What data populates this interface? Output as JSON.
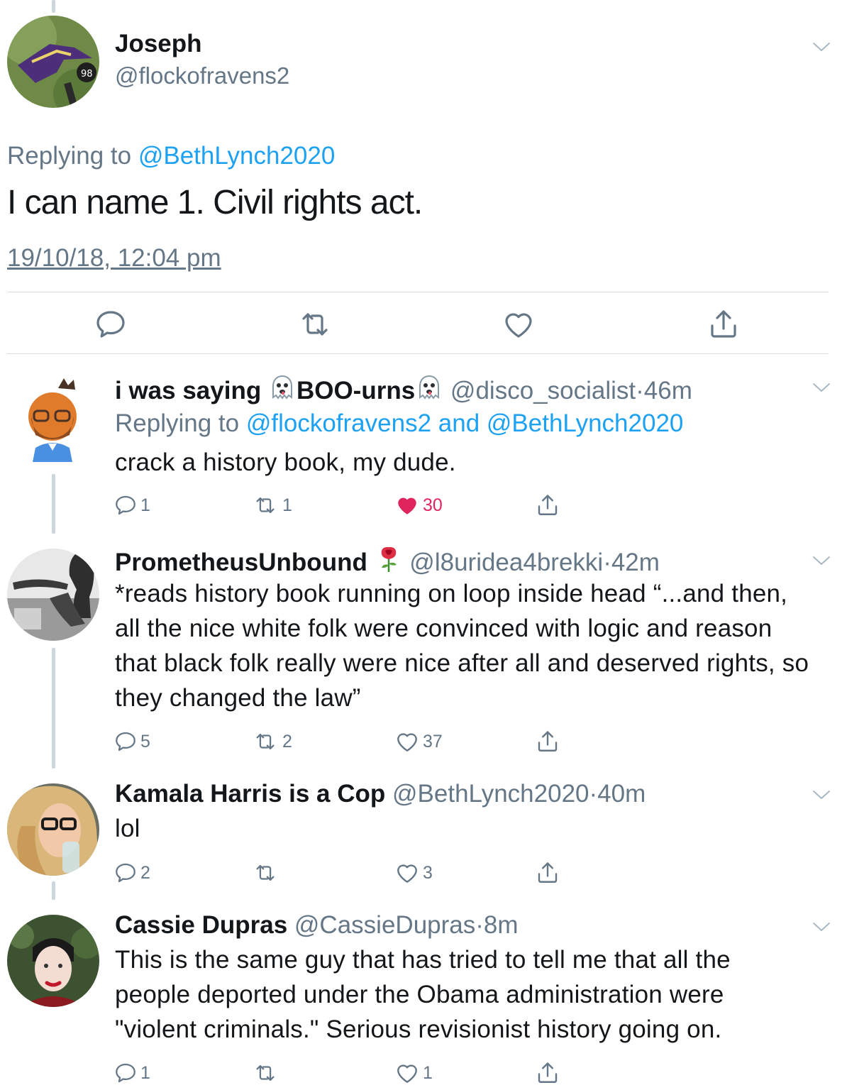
{
  "main_tweet": {
    "author_name": "Joseph",
    "author_handle": "@flockofravens2",
    "replying_prefix": "Replying to",
    "replying_to": "@BethLynch2020",
    "text": "I can name 1. Civil rights act.",
    "timestamp": "19/10/18, 12:04 pm"
  },
  "replies": [
    {
      "name_part1": "i was saying",
      "name_part2": "BOO-urns",
      "handle": "@disco_socialist",
      "separator": "·",
      "time": "46m",
      "replying_prefix": "Replying to",
      "replying_to": "@flockofravens2 and @BethLynch2020",
      "text": "crack a history book, my dude.",
      "reply_count": "1",
      "retweet_count": "1",
      "like_count": "30",
      "liked": true
    },
    {
      "name": "PrometheusUnbound",
      "handle": "@l8uridea4brekki",
      "separator": "·",
      "time": "42m",
      "text": "*reads history book running on loop inside head “...and then, all the nice white folk were convinced with logic and reason that black folk really were nice after all and deserved rights, so they changed the law”",
      "reply_count": "5",
      "retweet_count": "2",
      "like_count": "37"
    },
    {
      "name": "Kamala Harris is a Cop",
      "handle": "@BethLynch2020",
      "separator": "·",
      "time": "40m",
      "text": "lol",
      "reply_count": "2",
      "retweet_count": "",
      "like_count": "3"
    },
    {
      "name": "Cassie Dupras",
      "handle": "@CassieDupras",
      "separator": "·",
      "time": "8m",
      "text": "This is the same guy that has tried to tell me that all the people deported under the Obama administration were \"violent criminals.\" Serious revisionist history going on.",
      "reply_count": "1",
      "retweet_count": "",
      "like_count": "1"
    }
  ],
  "icons": {
    "reply": "reply-icon",
    "retweet": "retweet-icon",
    "like": "heart-icon",
    "share": "share-icon",
    "more": "chevron-down-icon",
    "ghost_emoji": "ghost-emoji-icon",
    "rose_emoji": "rose-emoji-icon"
  },
  "colors": {
    "link": "#1da1f2",
    "muted": "#657786",
    "like_active": "#e0245e",
    "thread_line": "#ccd6dd"
  }
}
